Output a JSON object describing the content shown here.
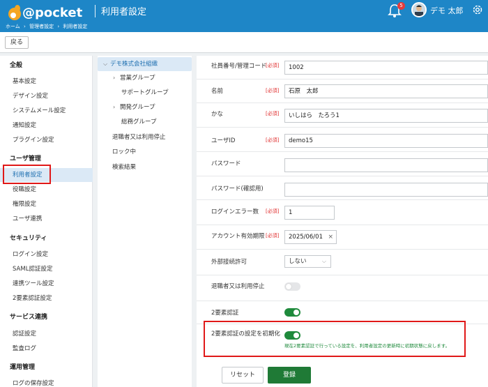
{
  "header": {
    "logo_text": "@pocket",
    "title": "利用者設定",
    "breadcrumb": [
      "ホーム",
      "›",
      "管理者設定",
      "›",
      "利用者設定"
    ],
    "notification_count": "5",
    "user_name": "デモ 太郎"
  },
  "toolbar": {
    "back_label": "戻る"
  },
  "sidebar": {
    "sections": [
      {
        "title": "全般",
        "items": [
          "基本設定",
          "デザイン設定",
          "システムメール設定",
          "通知設定",
          "プラグイン設定"
        ]
      },
      {
        "title": "ユーザ管理",
        "items": [
          "利用者設定",
          "役職設定",
          "権限設定",
          "ユーザ連携"
        ]
      },
      {
        "title": "セキュリティ",
        "items": [
          "ログイン設定",
          "SAML認証設定",
          "連携ツール設定",
          "2要素認証設定"
        ]
      },
      {
        "title": "サービス連携",
        "items": [
          "認証設定",
          "監査ログ"
        ]
      },
      {
        "title": "運用管理",
        "items": [
          "ログの保存設定"
        ]
      }
    ],
    "active_item": "利用者設定"
  },
  "tree": {
    "root": "デモ株式会社組織",
    "nodes": [
      "営業グループ",
      "サポートグループ",
      "開発グループ",
      "総務グループ"
    ],
    "extra": [
      "退職者又は利用停止",
      "ロック中",
      "検索結果"
    ]
  },
  "form": {
    "required_label": "[必須]",
    "employee_id": {
      "label": "社員番号/管理コード",
      "value": "1002"
    },
    "name": {
      "label": "名前",
      "value": "石原　太郎"
    },
    "kana": {
      "label": "かな",
      "value": "いしはら　たろう1"
    },
    "user_id": {
      "label": "ユーザID",
      "value": "demo15"
    },
    "password": {
      "label": "パスワード",
      "value": ""
    },
    "password_confirm": {
      "label": "パスワード(確認用)",
      "value": ""
    },
    "login_errors": {
      "label": "ログインエラー数",
      "value": "1"
    },
    "account_expiry": {
      "label": "アカウント有効期限",
      "value": "2025/06/01"
    },
    "external_access": {
      "label": "外部接続許可",
      "value": "しない"
    },
    "retired": {
      "label": "退職者又は利用停止",
      "enabled": false
    },
    "two_factor": {
      "label": "2要素認証",
      "enabled": true
    },
    "reset_two_factor": {
      "label": "2要素認証の設定を初期化",
      "enabled": true,
      "hint": "現在2要素認証で行っている設定を、利用者設定の更新時に初期状態に戻します。"
    },
    "reset_button": "リセット",
    "save_button": "登録"
  },
  "colors": {
    "header": "#1e86c7",
    "accent_green": "#1f7a36",
    "highlight": "#e01818"
  }
}
